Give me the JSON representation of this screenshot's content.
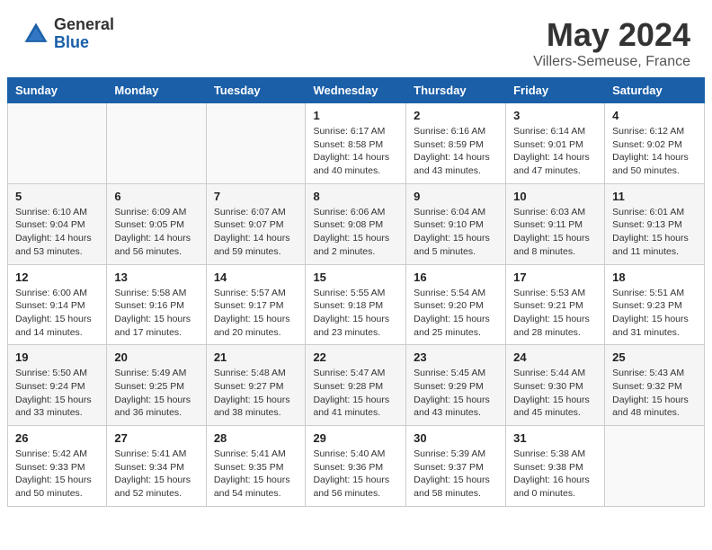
{
  "header": {
    "logo_general": "General",
    "logo_blue": "Blue",
    "title": "May 2024",
    "location": "Villers-Semeuse, France"
  },
  "days_of_week": [
    "Sunday",
    "Monday",
    "Tuesday",
    "Wednesday",
    "Thursday",
    "Friday",
    "Saturday"
  ],
  "weeks": [
    [
      {
        "day": "",
        "sunrise": "",
        "sunset": "",
        "daylight": ""
      },
      {
        "day": "",
        "sunrise": "",
        "sunset": "",
        "daylight": ""
      },
      {
        "day": "",
        "sunrise": "",
        "sunset": "",
        "daylight": ""
      },
      {
        "day": "1",
        "sunrise": "Sunrise: 6:17 AM",
        "sunset": "Sunset: 8:58 PM",
        "daylight": "Daylight: 14 hours and 40 minutes."
      },
      {
        "day": "2",
        "sunrise": "Sunrise: 6:16 AM",
        "sunset": "Sunset: 8:59 PM",
        "daylight": "Daylight: 14 hours and 43 minutes."
      },
      {
        "day": "3",
        "sunrise": "Sunrise: 6:14 AM",
        "sunset": "Sunset: 9:01 PM",
        "daylight": "Daylight: 14 hours and 47 minutes."
      },
      {
        "day": "4",
        "sunrise": "Sunrise: 6:12 AM",
        "sunset": "Sunset: 9:02 PM",
        "daylight": "Daylight: 14 hours and 50 minutes."
      }
    ],
    [
      {
        "day": "5",
        "sunrise": "Sunrise: 6:10 AM",
        "sunset": "Sunset: 9:04 PM",
        "daylight": "Daylight: 14 hours and 53 minutes."
      },
      {
        "day": "6",
        "sunrise": "Sunrise: 6:09 AM",
        "sunset": "Sunset: 9:05 PM",
        "daylight": "Daylight: 14 hours and 56 minutes."
      },
      {
        "day": "7",
        "sunrise": "Sunrise: 6:07 AM",
        "sunset": "Sunset: 9:07 PM",
        "daylight": "Daylight: 14 hours and 59 minutes."
      },
      {
        "day": "8",
        "sunrise": "Sunrise: 6:06 AM",
        "sunset": "Sunset: 9:08 PM",
        "daylight": "Daylight: 15 hours and 2 minutes."
      },
      {
        "day": "9",
        "sunrise": "Sunrise: 6:04 AM",
        "sunset": "Sunset: 9:10 PM",
        "daylight": "Daylight: 15 hours and 5 minutes."
      },
      {
        "day": "10",
        "sunrise": "Sunrise: 6:03 AM",
        "sunset": "Sunset: 9:11 PM",
        "daylight": "Daylight: 15 hours and 8 minutes."
      },
      {
        "day": "11",
        "sunrise": "Sunrise: 6:01 AM",
        "sunset": "Sunset: 9:13 PM",
        "daylight": "Daylight: 15 hours and 11 minutes."
      }
    ],
    [
      {
        "day": "12",
        "sunrise": "Sunrise: 6:00 AM",
        "sunset": "Sunset: 9:14 PM",
        "daylight": "Daylight: 15 hours and 14 minutes."
      },
      {
        "day": "13",
        "sunrise": "Sunrise: 5:58 AM",
        "sunset": "Sunset: 9:16 PM",
        "daylight": "Daylight: 15 hours and 17 minutes."
      },
      {
        "day": "14",
        "sunrise": "Sunrise: 5:57 AM",
        "sunset": "Sunset: 9:17 PM",
        "daylight": "Daylight: 15 hours and 20 minutes."
      },
      {
        "day": "15",
        "sunrise": "Sunrise: 5:55 AM",
        "sunset": "Sunset: 9:18 PM",
        "daylight": "Daylight: 15 hours and 23 minutes."
      },
      {
        "day": "16",
        "sunrise": "Sunrise: 5:54 AM",
        "sunset": "Sunset: 9:20 PM",
        "daylight": "Daylight: 15 hours and 25 minutes."
      },
      {
        "day": "17",
        "sunrise": "Sunrise: 5:53 AM",
        "sunset": "Sunset: 9:21 PM",
        "daylight": "Daylight: 15 hours and 28 minutes."
      },
      {
        "day": "18",
        "sunrise": "Sunrise: 5:51 AM",
        "sunset": "Sunset: 9:23 PM",
        "daylight": "Daylight: 15 hours and 31 minutes."
      }
    ],
    [
      {
        "day": "19",
        "sunrise": "Sunrise: 5:50 AM",
        "sunset": "Sunset: 9:24 PM",
        "daylight": "Daylight: 15 hours and 33 minutes."
      },
      {
        "day": "20",
        "sunrise": "Sunrise: 5:49 AM",
        "sunset": "Sunset: 9:25 PM",
        "daylight": "Daylight: 15 hours and 36 minutes."
      },
      {
        "day": "21",
        "sunrise": "Sunrise: 5:48 AM",
        "sunset": "Sunset: 9:27 PM",
        "daylight": "Daylight: 15 hours and 38 minutes."
      },
      {
        "day": "22",
        "sunrise": "Sunrise: 5:47 AM",
        "sunset": "Sunset: 9:28 PM",
        "daylight": "Daylight: 15 hours and 41 minutes."
      },
      {
        "day": "23",
        "sunrise": "Sunrise: 5:45 AM",
        "sunset": "Sunset: 9:29 PM",
        "daylight": "Daylight: 15 hours and 43 minutes."
      },
      {
        "day": "24",
        "sunrise": "Sunrise: 5:44 AM",
        "sunset": "Sunset: 9:30 PM",
        "daylight": "Daylight: 15 hours and 45 minutes."
      },
      {
        "day": "25",
        "sunrise": "Sunrise: 5:43 AM",
        "sunset": "Sunset: 9:32 PM",
        "daylight": "Daylight: 15 hours and 48 minutes."
      }
    ],
    [
      {
        "day": "26",
        "sunrise": "Sunrise: 5:42 AM",
        "sunset": "Sunset: 9:33 PM",
        "daylight": "Daylight: 15 hours and 50 minutes."
      },
      {
        "day": "27",
        "sunrise": "Sunrise: 5:41 AM",
        "sunset": "Sunset: 9:34 PM",
        "daylight": "Daylight: 15 hours and 52 minutes."
      },
      {
        "day": "28",
        "sunrise": "Sunrise: 5:41 AM",
        "sunset": "Sunset: 9:35 PM",
        "daylight": "Daylight: 15 hours and 54 minutes."
      },
      {
        "day": "29",
        "sunrise": "Sunrise: 5:40 AM",
        "sunset": "Sunset: 9:36 PM",
        "daylight": "Daylight: 15 hours and 56 minutes."
      },
      {
        "day": "30",
        "sunrise": "Sunrise: 5:39 AM",
        "sunset": "Sunset: 9:37 PM",
        "daylight": "Daylight: 15 hours and 58 minutes."
      },
      {
        "day": "31",
        "sunrise": "Sunrise: 5:38 AM",
        "sunset": "Sunset: 9:38 PM",
        "daylight": "Daylight: 16 hours and 0 minutes."
      },
      {
        "day": "",
        "sunrise": "",
        "sunset": "",
        "daylight": ""
      }
    ]
  ]
}
